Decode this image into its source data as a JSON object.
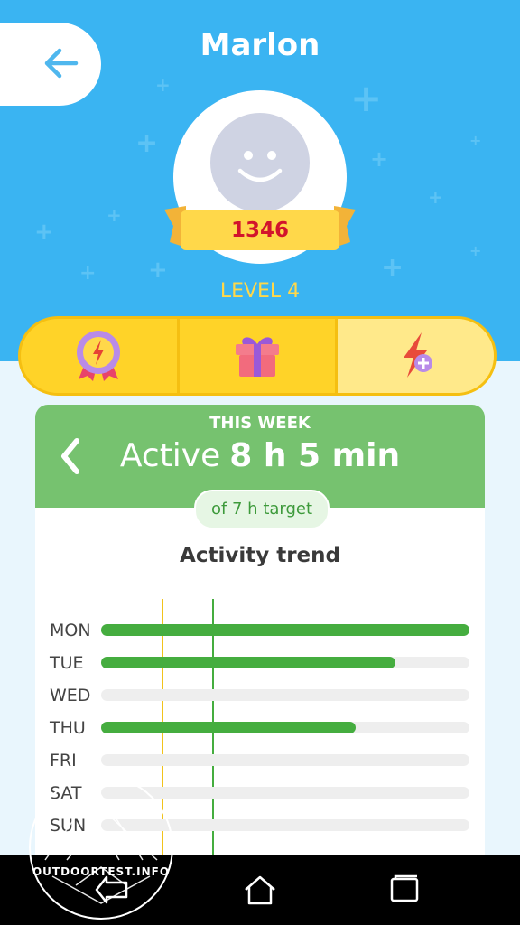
{
  "header": {
    "title": "Marlon",
    "score": "1346",
    "level": "LEVEL 4"
  },
  "tabs": [
    {
      "name": "achievements",
      "icon": "badge-icon"
    },
    {
      "name": "rewards",
      "icon": "gift-icon"
    },
    {
      "name": "boost",
      "icon": "bolt-plus-icon"
    }
  ],
  "week": {
    "label": "THIS WEEK",
    "active_label": "Active",
    "active_value": "8 h 5 min",
    "target": "of 7 h target",
    "trend_title": "Activity trend",
    "days": [
      {
        "label": "MON",
        "fraction": 1.0
      },
      {
        "label": "TUE",
        "fraction": 0.8
      },
      {
        "label": "WED",
        "fraction": 0
      },
      {
        "label": "THU",
        "fraction": 0.69
      },
      {
        "label": "FRI",
        "fraction": 0
      },
      {
        "label": "SAT",
        "fraction": 0
      },
      {
        "label": "SUN",
        "fraction": 0
      }
    ]
  },
  "watermark": "OUTDOORTEST.INFO",
  "colors": {
    "header": "#3ab4f2",
    "accent": "#ffd328",
    "green": "#76c26f",
    "bar": "#45ad3f"
  }
}
